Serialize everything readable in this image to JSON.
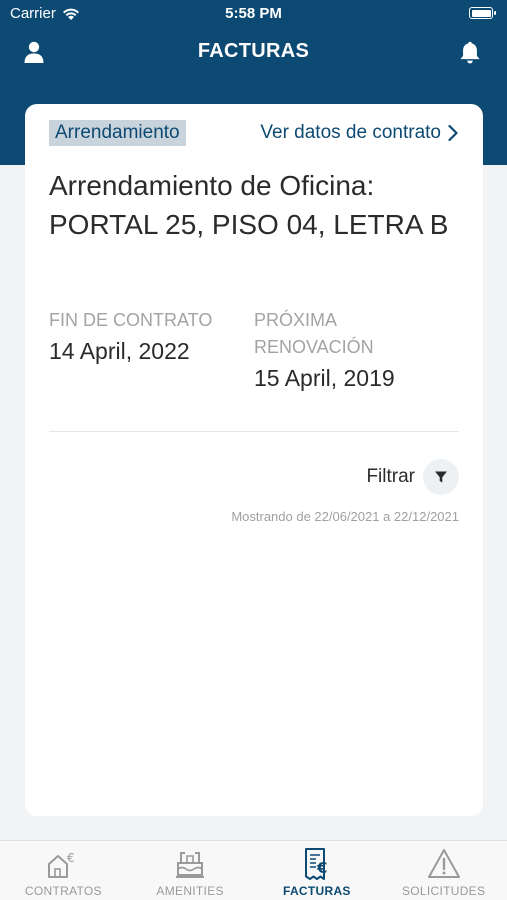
{
  "status_bar": {
    "carrier": "Carrier",
    "time": "5:58 PM"
  },
  "nav": {
    "title": "FACTURAS",
    "left_icon": "user-icon",
    "right_icon": "bell-icon"
  },
  "card": {
    "tag": "Arrendamiento",
    "contract_link": "Ver datos de contrato",
    "title": "Arrendamiento de Oficina: PORTAL 25, PISO 04, LETRA B",
    "end_date": {
      "label": "FIN DE CONTRATO",
      "value": "14 April, 2022"
    },
    "renewal_date": {
      "label": "PRÓXIMA RENOVACIÓN",
      "value": "15 April, 2019"
    },
    "filter_label": "Filtrar",
    "range_text": "Mostrando de 22/06/2021 a 22/12/2021"
  },
  "tabs": [
    {
      "label": "CONTRATOS",
      "icon": "house-euro-icon",
      "active": false
    },
    {
      "label": "AMENITIES",
      "icon": "amenities-icon",
      "active": false
    },
    {
      "label": "FACTURAS",
      "icon": "invoice-euro-icon",
      "active": true
    },
    {
      "label": "SOLICITUDES",
      "icon": "warning-icon",
      "active": false
    }
  ],
  "colors": {
    "primary": "#0d4a73",
    "tag_bg": "#c9d3dc",
    "background": "#f1f3f5"
  }
}
